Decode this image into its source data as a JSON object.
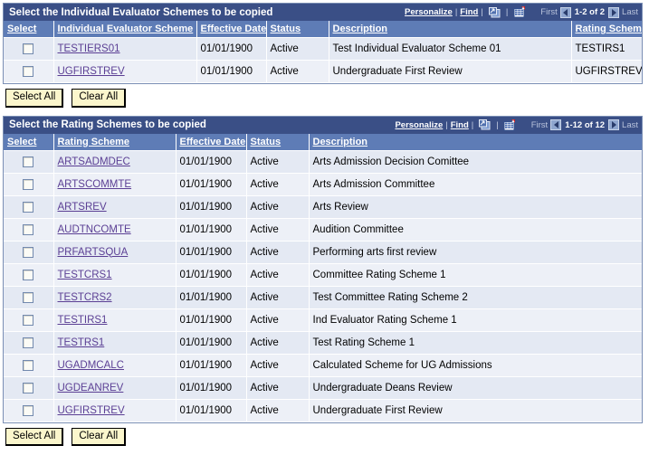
{
  "sections": [
    {
      "title": "Select the Individual Evaluator Schemes to be copied",
      "toolbar": {
        "personalize_label": "Personalize",
        "find_label": "Find",
        "separator": "|",
        "zoom_icon": "view-all-expand-icon",
        "download_icon": "download-to-spreadsheet-icon"
      },
      "pagination": {
        "first_label": "First",
        "prev_icon": "previous-page-arrow-icon",
        "range_label": "1-2 of 2",
        "next_icon": "next-page-arrow-icon",
        "last_label": "Last"
      },
      "columns": [
        "Select",
        "Individual Evaluator Scheme",
        "Effective Date",
        "Status",
        "Description",
        "Rating Scheme"
      ],
      "rows": [
        {
          "selected": false,
          "scheme": "TESTIERS01",
          "effective_date": "01/01/1900",
          "status": "Active",
          "description": "Test Individual Evaluator Scheme 01",
          "rating_scheme": "TESTIRS1"
        },
        {
          "selected": false,
          "scheme": "UGFIRSTREV",
          "effective_date": "01/01/1900",
          "status": "Active",
          "description": "Undergraduate First Review",
          "rating_scheme": "UGFIRSTREV"
        }
      ],
      "buttons": {
        "select_all": "Select All",
        "clear_all": "Clear All"
      }
    },
    {
      "title": "Select the Rating Schemes to be copied",
      "toolbar": {
        "personalize_label": "Personalize",
        "find_label": "Find",
        "separator": "|",
        "zoom_icon": "view-all-expand-icon",
        "download_icon": "download-to-spreadsheet-icon"
      },
      "pagination": {
        "first_label": "First",
        "prev_icon": "previous-page-arrow-icon",
        "range_label": "1-12 of 12",
        "next_icon": "next-page-arrow-icon",
        "last_label": "Last"
      },
      "columns": [
        "Select",
        "Rating Scheme",
        "Effective Date",
        "Status",
        "Description"
      ],
      "rows": [
        {
          "selected": false,
          "scheme": "ARTSADMDEC",
          "effective_date": "01/01/1900",
          "status": "Active",
          "description": "Arts Admission Decision Comittee"
        },
        {
          "selected": false,
          "scheme": "ARTSCOMMTE",
          "effective_date": "01/01/1900",
          "status": "Active",
          "description": "Arts Admission Committee"
        },
        {
          "selected": false,
          "scheme": "ARTSREV",
          "effective_date": "01/01/1900",
          "status": "Active",
          "description": "Arts Review"
        },
        {
          "selected": false,
          "scheme": "AUDTNCOMTE",
          "effective_date": "01/01/1900",
          "status": "Active",
          "description": "Audition Committee"
        },
        {
          "selected": false,
          "scheme": "PRFARTSQUA",
          "effective_date": "01/01/1900",
          "status": "Active",
          "description": "Performing arts first review"
        },
        {
          "selected": false,
          "scheme": "TESTCRS1",
          "effective_date": "01/01/1900",
          "status": "Active",
          "description": "Committee Rating Scheme 1"
        },
        {
          "selected": false,
          "scheme": "TESTCRS2",
          "effective_date": "01/01/1900",
          "status": "Active",
          "description": "Test Committee Rating Scheme 2"
        },
        {
          "selected": false,
          "scheme": "TESTIRS1",
          "effective_date": "01/01/1900",
          "status": "Active",
          "description": "Ind Evaluator Rating Scheme 1"
        },
        {
          "selected": false,
          "scheme": "TESTRS1",
          "effective_date": "01/01/1900",
          "status": "Active",
          "description": "Test Rating Scheme 1"
        },
        {
          "selected": false,
          "scheme": "UGADMCALC",
          "effective_date": "01/01/1900",
          "status": "Active",
          "description": "Calculated Scheme for UG Admissions"
        },
        {
          "selected": false,
          "scheme": "UGDEANREV",
          "effective_date": "01/01/1900",
          "status": "Active",
          "description": "Undergraduate Deans Review"
        },
        {
          "selected": false,
          "scheme": "UGFIRSTREV",
          "effective_date": "01/01/1900",
          "status": "Active",
          "description": "Undergraduate First Review"
        }
      ],
      "buttons": {
        "select_all": "Select All",
        "clear_all": "Clear All"
      }
    }
  ],
  "colors": {
    "title_bar": "#3a4f86",
    "column_header": "#5e7cb6",
    "row_odd": "#e4e9f3",
    "row_even": "#edf0f7",
    "link": "#5b3f94",
    "button": "#fbf6cc",
    "grid_border": "#7b8fb5"
  }
}
